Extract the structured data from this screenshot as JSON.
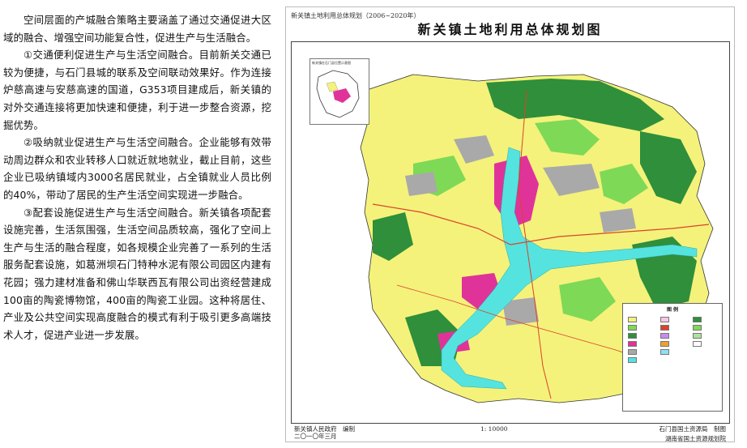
{
  "article": {
    "paragraphs": [
      "空间层面的产城融合策略主要涵盖了通过交通促进大区域的融合、增强空间功能复合性，促进生产与生活融合。",
      "①交通便利促进生产与生活空间融合。目前新关交通已较为便捷，与石门县城的联系及空间联动效果好。作为连接炉慈高速与安慈高速的国道，G353项目建成后，新关镇的对外交通连接将更加快速和便捷，利于进一步整合资源，挖掘优势。",
      "②吸纳就业促进生产与生活空间融合。企业能够有效带动周边群众和农业转移人口就近就地就业，截止目前，这些企业已吸纳镇域内3000名居民就业，占全镇就业人员比例的40%，带动了居民的生产生活空间实现进一步融合。",
      "③配套设施促进生产与生活空间融合。新关镇各项配套设施完善，生活氛围强，生活空间品质较高，强化了空间上生产与生活的融合程度，如各规模企业完善了一系列的生活服务配套设施，如葛洲坝石门特种水泥有限公司园区内建有花园；强力建材准备和佛山华联西瓦有限公司出资经营建成100亩的陶瓷博物馆，400亩的陶瓷工业园。这种将居住、产业及公共空间实现高度融合的模式有利于吸引更多高端技术人才，促进产业进一步发展。"
    ]
  },
  "map": {
    "subtitle": "新关镇土地利用总体规划（2006~2020年）",
    "title": "新关镇土地利用总体规划图",
    "locator_label": "新关镇在石门县位置示意图",
    "legend_title": "图 例",
    "footer_left_1": "新关镇人民政府　编制",
    "footer_left_2": "二〇一〇年三月",
    "footer_scale": "1: 10000",
    "footer_right_1": "石门县国土资源局　制图",
    "footer_right_2": "湖南省国土资源规划院",
    "colors": {
      "river": "#55e3e0",
      "town": "#e0339a",
      "industrial": "#a9a9a9",
      "farmland": "#f4f27a",
      "forest": "#2f8f3a",
      "garden": "#7ed957",
      "road": "#d9442b"
    }
  }
}
